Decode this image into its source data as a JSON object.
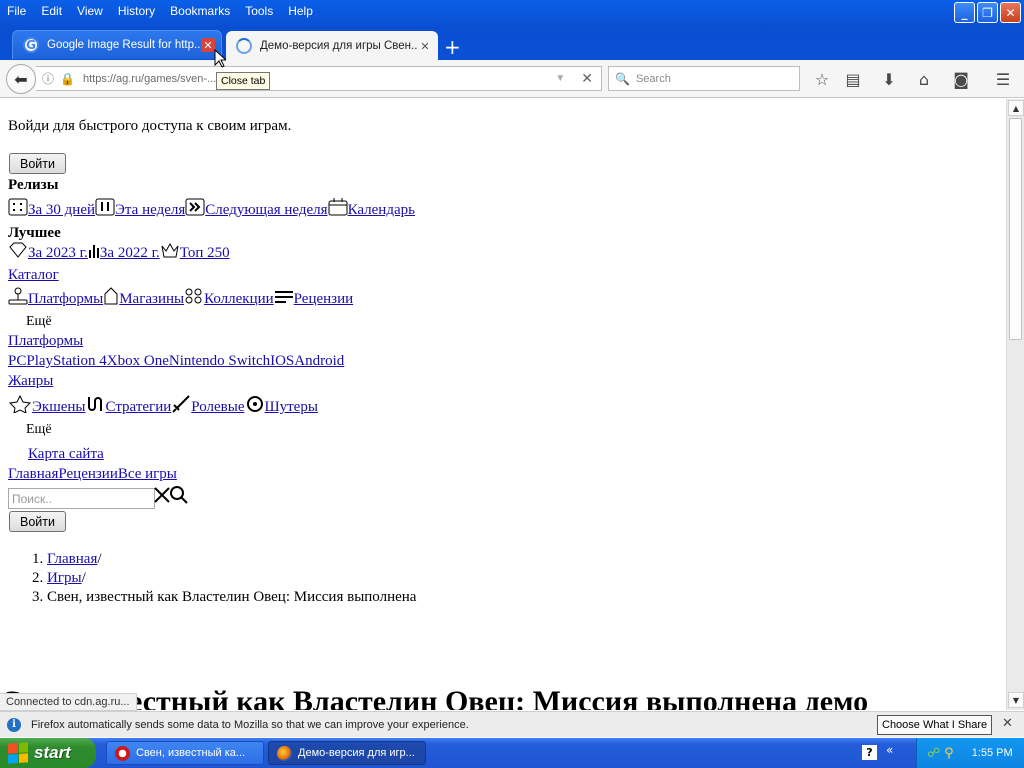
{
  "menu": [
    "File",
    "Edit",
    "View",
    "History",
    "Bookmarks",
    "Tools",
    "Help"
  ],
  "window_buttons": {
    "minimize": "_",
    "maximize": "❐",
    "close": "✕"
  },
  "tabs": [
    {
      "label": "Google Image Result for http...",
      "close": "✕"
    },
    {
      "label": "Демо-версия для игры Свен...",
      "close": "✕"
    }
  ],
  "new_tab": "+",
  "tooltip": "Close tab",
  "url": "https://ag.ru/games/sven-...-os",
  "search_placeholder": "Search",
  "page": {
    "login_prompt": "Войди для быстрого доступа к своим играм.",
    "login_button": "Войти",
    "releases_heading": "Релизы",
    "releases": [
      "За 30 дней",
      "Эта неделя",
      "Следующая неделя",
      "Календарь"
    ],
    "best_heading": "Лучшее",
    "best": [
      "За 2023 г.",
      "За 2022 г.",
      "Топ 250"
    ],
    "catalog": "Каталог",
    "catalog_items": [
      "Платформы",
      "Магазины",
      "Коллекции",
      "Рецензии"
    ],
    "more1": "Ещё",
    "platforms_heading": "Платформы",
    "platforms": [
      "PC",
      "PlayStation 4",
      "Xbox One",
      "Nintendo Switch",
      "IOS",
      "Android"
    ],
    "genres_heading": "Жанры",
    "genres": [
      "Экшены",
      "Стратегии",
      "Ролевые",
      "Шутеры"
    ],
    "more2": "Ещё",
    "sitemap": "Карта сайта",
    "bottom_nav": [
      "Главная",
      "Рецензии",
      "Все игры"
    ],
    "search_placeholder": "Поиск..",
    "login_button2": "Войти",
    "breadcrumbs": [
      "Главная",
      "Игры",
      "Свен, известный как Властелин Овец: Миссия выполнена"
    ],
    "breadcrumb_sep": "/",
    "title": "Свен, известный как Властелин Овец: Миссия выполнена демо"
  },
  "status": "Connected to cdn.ag.ru...",
  "infobar": {
    "text": "Firefox automatically sends some data to Mozilla so that we can improve your experience.",
    "button": "Choose What I Share",
    "close": "✕"
  },
  "taskbar": {
    "start": "start",
    "tasks": [
      "Свен, известный ка...",
      "Демо-версия для игр..."
    ],
    "help": "?",
    "clock": "1:55 PM"
  },
  "colors": {
    "xp_blue": "#0a5fe8",
    "link": "#1a0dab",
    "start_green": "#2e8b2e",
    "tab_close_red": "#d9443a"
  }
}
